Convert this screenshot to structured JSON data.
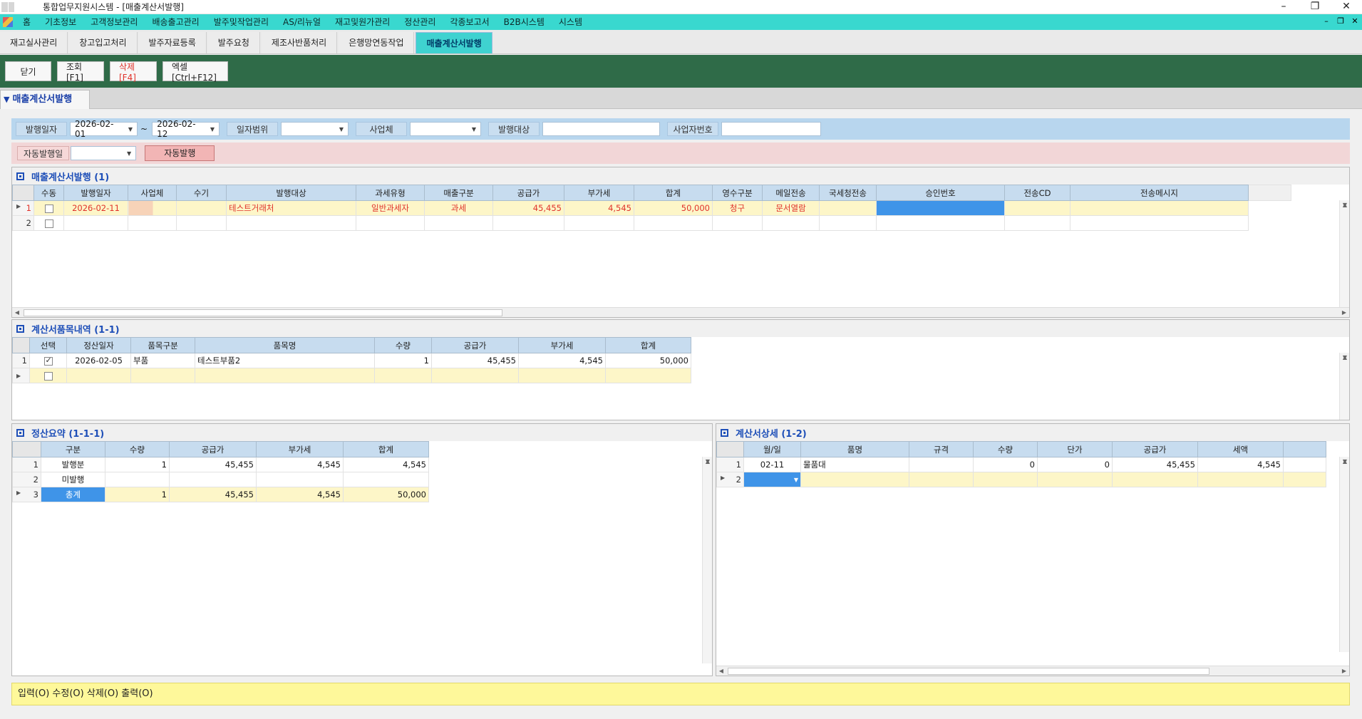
{
  "window": {
    "title": "통합업무지원시스템 - [매출계산서발행]",
    "controls": [
      "–",
      "❐",
      "✕"
    ]
  },
  "menu": {
    "items": [
      "홈",
      "기초정보",
      "고객정보관리",
      "배송출고관리",
      "발주및작업관리",
      "AS/리뉴얼",
      "재고및원가관리",
      "정산관리",
      "각종보고서",
      "B2B시스템",
      "시스템"
    ],
    "mdi_controls": [
      "–",
      "❐",
      "✕"
    ]
  },
  "tabs": [
    "재고실사관리",
    "창고입고처리",
    "발주자료등록",
    "발주요청",
    "제조사반품처리",
    "은행망연동작업",
    "매출계산서발행"
  ],
  "active_tab": "매출계산서발행",
  "toolbar": {
    "close": "닫기",
    "search": "조회[F1]",
    "delete": "삭제[F4]",
    "excel": "엑셀[Ctrl+F12]"
  },
  "section_tab": "매출계산서발행",
  "filter": {
    "issue_date_label": "발행일자",
    "date_from": "2026-02-01",
    "tilde": "~",
    "date_to": "2026-02-12",
    "date_range_label": "일자범위",
    "date_range_value": "",
    "business_label": "사업체",
    "business_value": "",
    "target_label": "발행대상",
    "target_value": "",
    "biz_no_label": "사업자번호",
    "biz_no_value": "",
    "auto_issue_date_label": "자동발행일",
    "auto_issue_date_value": "",
    "auto_issue_button": "자동발행"
  },
  "invoice_grid": {
    "title": "매출계산서발행 (1)",
    "columns": [
      "수동",
      "발행일자",
      "사업체",
      "수기",
      "발행대상",
      "과세유형",
      "매출구분",
      "공급가",
      "부가세",
      "합계",
      "영수구분",
      "메일전송",
      "국세청전송",
      "승인번호",
      "전송CD",
      "전송메시지"
    ],
    "rows": [
      {
        "no": "1",
        "manual": "",
        "issue_date": "2026-02-11",
        "business": "",
        "handwritten": "",
        "target": "테스트거래처",
        "tax_type": "일반과세자",
        "sales_type": "과세",
        "supply": "45,455",
        "vat": "4,545",
        "total": "50,000",
        "receipt_type": "청구",
        "mail": "문서열람",
        "nts": "",
        "approval_no": "",
        "send_cd": "",
        "send_msg": ""
      },
      {
        "no": "2",
        "manual": "",
        "issue_date": "",
        "business": "",
        "handwritten": "",
        "target": "",
        "tax_type": "",
        "sales_type": "",
        "supply": "",
        "vat": "",
        "total": "",
        "receipt_type": "",
        "mail": "",
        "nts": "",
        "approval_no": "",
        "send_cd": "",
        "send_msg": ""
      }
    ]
  },
  "items_grid": {
    "title": "계산서품목내역 (1-1)",
    "columns": [
      "선택",
      "정산일자",
      "품목구분",
      "품목명",
      "수량",
      "공급가",
      "부가세",
      "합계"
    ],
    "rows": [
      {
        "no": "1",
        "date": "2026-02-05",
        "category": "부품",
        "name": "테스트부품2",
        "qty": "1",
        "supply": "45,455",
        "vat": "4,545",
        "total": "50,000"
      },
      {
        "no": "",
        "date": "",
        "category": "",
        "name": "",
        "qty": "",
        "supply": "",
        "vat": "",
        "total": ""
      }
    ]
  },
  "summary_grid": {
    "title": "정산요약 (1-1-1)",
    "columns": [
      "구분",
      "수량",
      "공급가",
      "부가세",
      "합계"
    ],
    "rows": [
      {
        "no": "1",
        "type": "발행분",
        "qty": "1",
        "supply": "45,455",
        "vat": "4,545",
        "total": "4,545"
      },
      {
        "no": "2",
        "type": "미발행",
        "qty": "",
        "supply": "",
        "vat": "",
        "total": ""
      },
      {
        "no": "3",
        "type": "총계",
        "qty": "1",
        "supply": "45,455",
        "vat": "4,545",
        "total": "50,000"
      }
    ]
  },
  "detail_grid": {
    "title": "계산서상세 (1-2)",
    "columns": [
      "월/일",
      "품명",
      "규격",
      "수량",
      "단가",
      "공급가",
      "세액"
    ],
    "rows": [
      {
        "no": "1",
        "md": "02-11",
        "name": "물품대",
        "spec": "",
        "qty": "0",
        "unit": "0",
        "supply": "45,455",
        "tax": "4,545"
      },
      {
        "no": "2",
        "md": "",
        "name": "",
        "spec": "",
        "qty": "",
        "unit": "",
        "supply": "",
        "tax": ""
      }
    ]
  },
  "status": "입력(O) 수정(O) 삭제(O) 출력(O)",
  "colors": {
    "menubar": "#39d8cf",
    "toolbar": "#2f6b48",
    "grid_header": "#c7dcef",
    "selected_cell": "#3f94e8",
    "row_highlight": "#fdf6c8",
    "red_text": "#e0332b",
    "status_bar": "#fef89a"
  }
}
